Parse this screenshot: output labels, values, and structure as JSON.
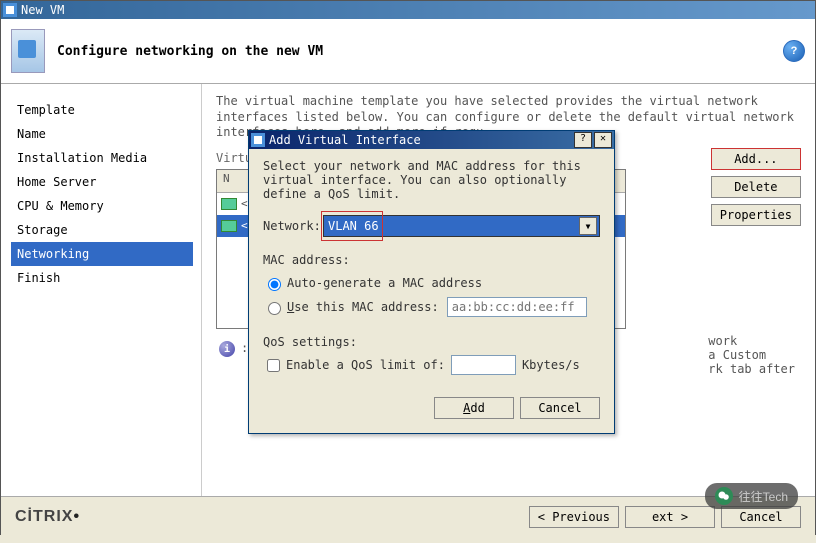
{
  "window": {
    "title": "New VM"
  },
  "header": {
    "title": "Configure networking on the new VM"
  },
  "nav": {
    "items": [
      {
        "label": "Template"
      },
      {
        "label": "Name"
      },
      {
        "label": "Installation Media"
      },
      {
        "label": "Home Server"
      },
      {
        "label": "CPU & Memory"
      },
      {
        "label": "Storage"
      },
      {
        "label": "Networking"
      },
      {
        "label": "Finish"
      }
    ],
    "selected_index": 6
  },
  "main": {
    "description": "The virtual machine template you have selected provides the virtual network interfaces listed below. You can configure or delete the default virtual network interfaces here, and add more if requ",
    "section_label": "Virtu",
    "list_header": "N",
    "rows": [
      {
        "text": "<"
      },
      {
        "text": "<"
      }
    ],
    "buttons": {
      "add": "Add...",
      "delete": "Delete",
      "properties": "Properties"
    },
    "hint_fragment_right": "work\na Custom\nrk tab after",
    "info_hint_prefix": ":"
  },
  "dialog": {
    "title": "Add Virtual Interface",
    "instruction": "Select your network and MAC address for this virtual interface. You can also optionally define a QoS limit.",
    "network_label": "Network:",
    "network_value": "VLAN 66",
    "mac_section": "MAC address:",
    "mac_auto": "Auto-generate a MAC address",
    "mac_use_prefix": "U",
    "mac_use_rest": "se this MAC address:",
    "mac_placeholder": "aa:bb:cc:dd:ee:ff",
    "mac_choice": "auto",
    "qos_section": "QoS settings:",
    "qos_enable": "Enable a QoS limit of:",
    "qos_unit": "Kbytes/s",
    "qos_checked": false,
    "add_btn_prefix": "A",
    "add_btn_rest": "dd",
    "cancel_btn": "Cancel"
  },
  "footer": {
    "brand": "CİTRIX",
    "brand_dot": "•",
    "previous": "< Previous",
    "next": "ext >",
    "cancel": "Cancel"
  },
  "watermark": {
    "text": "往往Tech"
  }
}
